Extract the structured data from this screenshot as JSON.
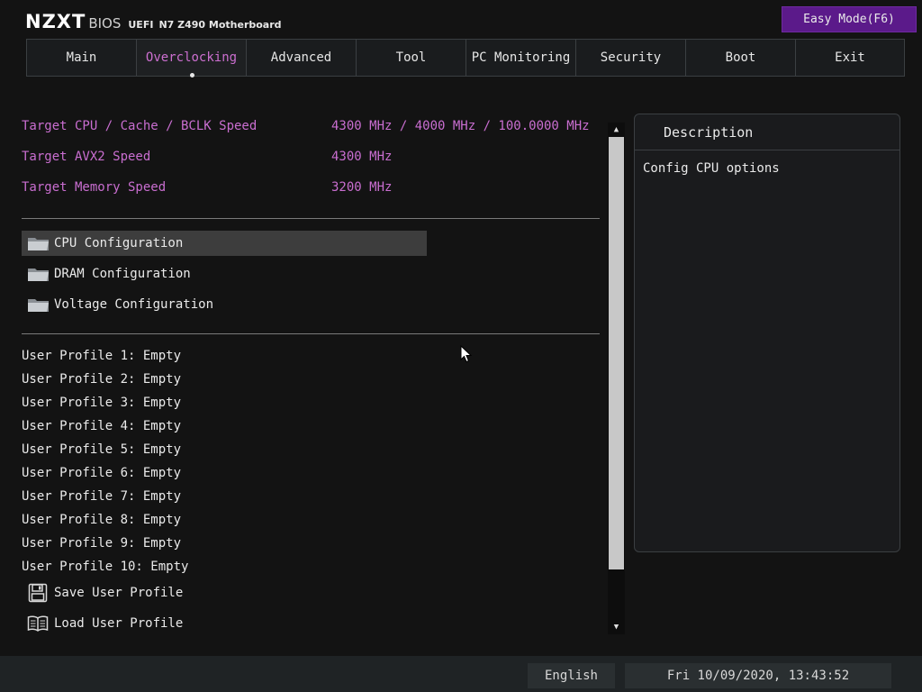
{
  "header": {
    "brand": "NZXT",
    "bios": "BIOS",
    "uefi": "UEFI",
    "model": "N7 Z490 Motherboard",
    "easy_mode": "Easy Mode(F6)"
  },
  "tabs": [
    {
      "label": "Main"
    },
    {
      "label": "Overclocking"
    },
    {
      "label": "Advanced"
    },
    {
      "label": "Tool"
    },
    {
      "label": "PC Monitoring"
    },
    {
      "label": "Security"
    },
    {
      "label": "Boot"
    },
    {
      "label": "Exit"
    }
  ],
  "active_tab": "Overclocking",
  "targets": [
    {
      "label": "Target CPU / Cache / BCLK Speed",
      "value": "4300 MHz / 4000 MHz / 100.0000 MHz"
    },
    {
      "label": "Target AVX2 Speed",
      "value": "4300 MHz"
    },
    {
      "label": "Target Memory Speed",
      "value": "3200 MHz"
    }
  ],
  "menu": [
    {
      "label": "CPU Configuration",
      "icon": "folder-icon"
    },
    {
      "label": "DRAM Configuration",
      "icon": "folder-icon"
    },
    {
      "label": "Voltage Configuration",
      "icon": "folder-icon"
    }
  ],
  "selected_menu": "CPU Configuration",
  "profiles": [
    "User Profile 1: Empty",
    "User Profile 2: Empty",
    "User Profile 3: Empty",
    "User Profile 4: Empty",
    "User Profile 5: Empty",
    "User Profile 6: Empty",
    "User Profile 7: Empty",
    "User Profile 8: Empty",
    "User Profile 9: Empty",
    "User Profile 10: Empty"
  ],
  "actions": [
    {
      "label": "Save User Profile",
      "icon": "floppy-disk-icon"
    },
    {
      "label": "Load User Profile",
      "icon": "open-book-icon"
    }
  ],
  "description": {
    "title": "Description",
    "text": "Config CPU options"
  },
  "footer": {
    "language": "English",
    "datetime": "Fri 10/09/2020, 13:43:52"
  },
  "colors": {
    "accent": "#c96ed0",
    "easy_mode_bg": "#5b1a8a",
    "background": "#131313"
  }
}
